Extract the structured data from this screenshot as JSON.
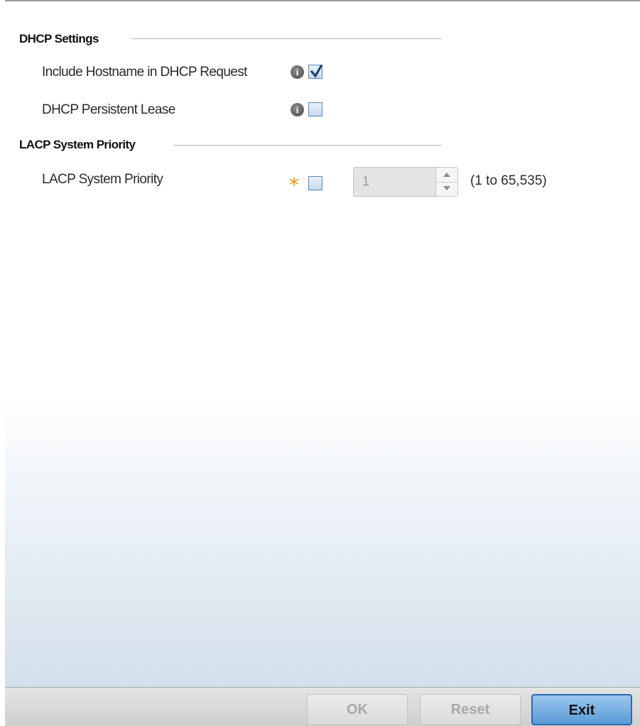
{
  "dhcp": {
    "header": "DHCP Settings",
    "include_hostname_label": "Include Hostname in DHCP Request",
    "include_hostname_checked": true,
    "persistent_lease_label": "DHCP Persistent Lease",
    "persistent_lease_checked": false
  },
  "lacp": {
    "header": "LACP System Priority",
    "priority_label": "LACP System Priority",
    "priority_enabled": false,
    "priority_value": "1",
    "priority_range": "(1 to 65,535)"
  },
  "footer": {
    "ok_label": "OK",
    "reset_label": "Reset",
    "exit_label": "Exit"
  },
  "colors": {
    "required_star": "#f0941c",
    "checkbox_border": "#5e86b3",
    "primary_button": "#5a9bd8"
  },
  "icons": {
    "info": "info-icon",
    "check": "checkmark-icon",
    "required": "asterisk-icon"
  }
}
